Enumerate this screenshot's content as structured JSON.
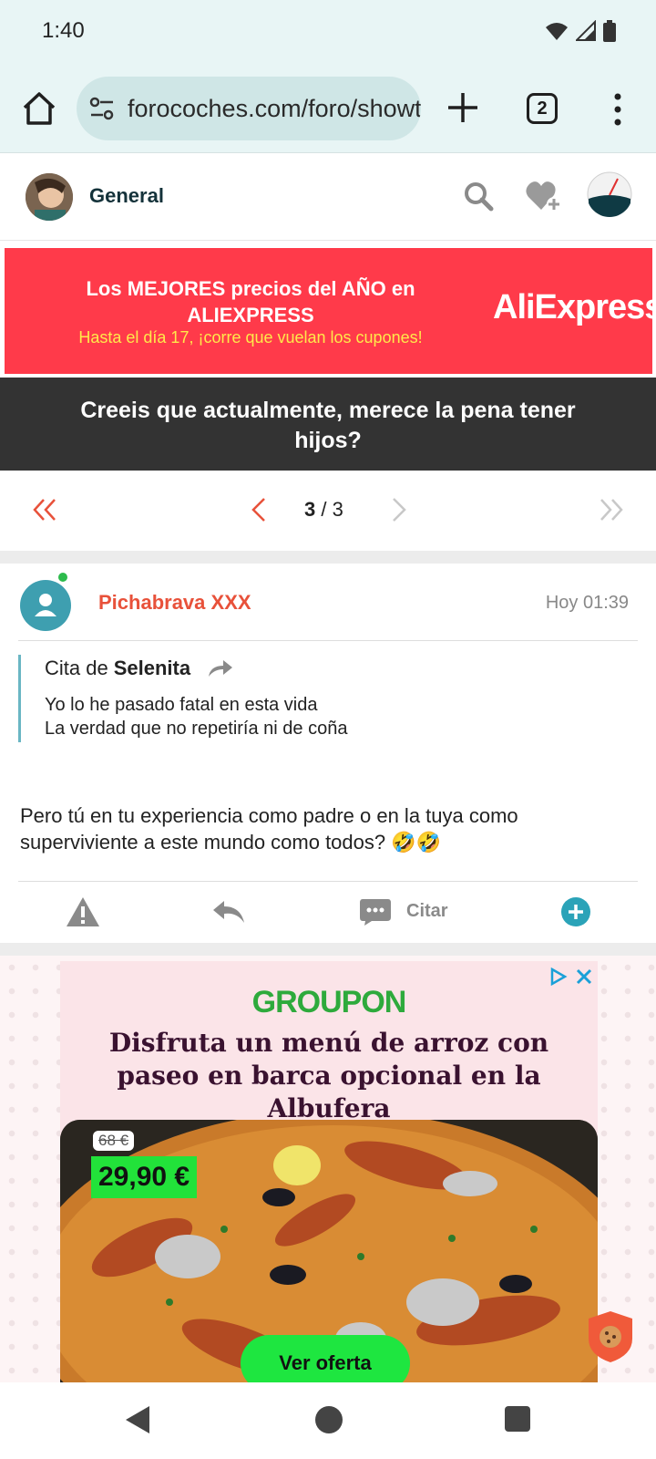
{
  "status_bar": {
    "time": "1:40"
  },
  "browser": {
    "url": "forocoches.com/foro/showthread.php",
    "tab_count": "2"
  },
  "site_header": {
    "section": "General"
  },
  "ad_banner": {
    "title": "Los MEJORES precios del AÑO en ALIEXPRESS",
    "subtitle": "Hasta el día 17, ¡corre que vuelan los cupones!",
    "logo": "AliExpress"
  },
  "thread": {
    "title": "Creeis que actualmente, merece la pena tener hijos?"
  },
  "pagination": {
    "current": "3",
    "total": "3"
  },
  "post": {
    "author": "Pichabrava XXX",
    "time": "Hoy 01:39",
    "quote": {
      "prefix": "Cita de",
      "quoted_user": "Selenita",
      "lines": [
        "Yo lo he pasado fatal en esta vida",
        "La verdad que no repetiría ni de coña"
      ]
    },
    "body": "Pero tú en tu experiencia como padre o en la tuya como superviviente a este mundo como todos? 🤣🤣",
    "actions": {
      "quote_label": "Citar"
    }
  },
  "groupon_ad": {
    "brand": "GROUPON",
    "headline": "Disfruta un menú de arroz con paseo en barca opcional en la Albufera",
    "old_price": "68 €",
    "new_price": "29,90 €",
    "cta": "Ver oferta"
  },
  "colors": {
    "accent": "#e8513a",
    "teal": "#2ba3b8",
    "ad_red": "#ff3a4a",
    "groupon_green": "#2eaa3c"
  }
}
